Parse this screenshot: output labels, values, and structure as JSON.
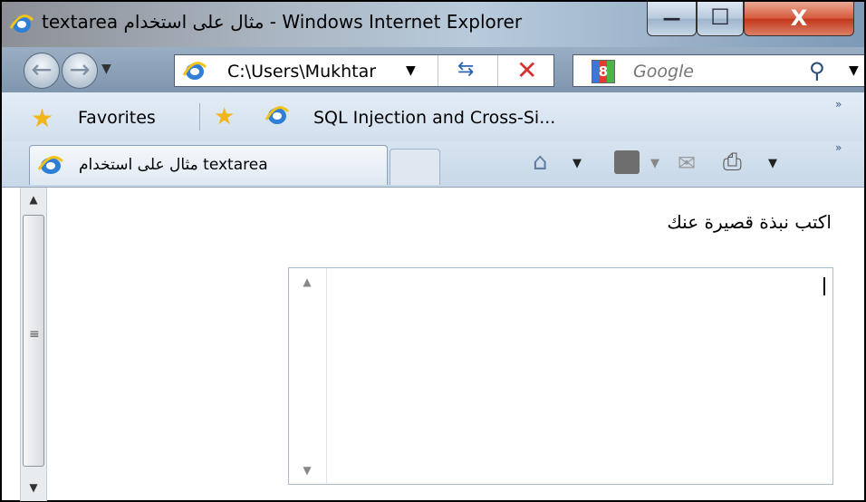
{
  "window": {
    "title": "textarea مثال على استخدام - Windows Internet Explorer",
    "controls": {
      "minimize": "—",
      "maximize": "☐",
      "close": "X"
    }
  },
  "nav": {
    "address": "C:\\Users\\Mukhtar",
    "search_placeholder": "Google",
    "search_provider_glyph": "8"
  },
  "favorites": {
    "label": "Favorites",
    "links": [
      "SQL Injection and Cross-Si..."
    ],
    "overflow": "»"
  },
  "tabs": {
    "items": [
      {
        "title": "مثال على استخدام textarea",
        "icon": "ie-icon"
      }
    ],
    "overflow": "»"
  },
  "page": {
    "prompt": "اكتب نبذة قصيرة عنك",
    "textarea_value": ""
  },
  "colors": {
    "accent": "#2e65b3",
    "close_button": "#c2361b"
  }
}
